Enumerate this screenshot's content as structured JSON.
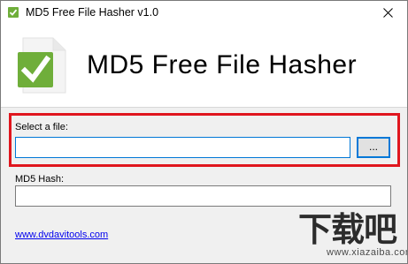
{
  "window": {
    "title": "MD5 Free File Hasher v1.0"
  },
  "header": {
    "title": "MD5 Free File Hasher"
  },
  "file_section": {
    "label": "Select a file:",
    "input_value": "",
    "browse_label": "..."
  },
  "hash_section": {
    "label": "MD5 Hash:",
    "value": ""
  },
  "footer": {
    "link_text": "www.dvdavitools.com"
  },
  "watermark": {
    "text": "下载吧",
    "url": "www.xiazaiba.com"
  },
  "icons": {
    "app": "check-icon",
    "close": "close-icon",
    "logo": "document-check-icon"
  },
  "colors": {
    "accent_blue": "#0078d7",
    "highlight_red": "#e0161e",
    "check_green": "#6fae3a"
  }
}
